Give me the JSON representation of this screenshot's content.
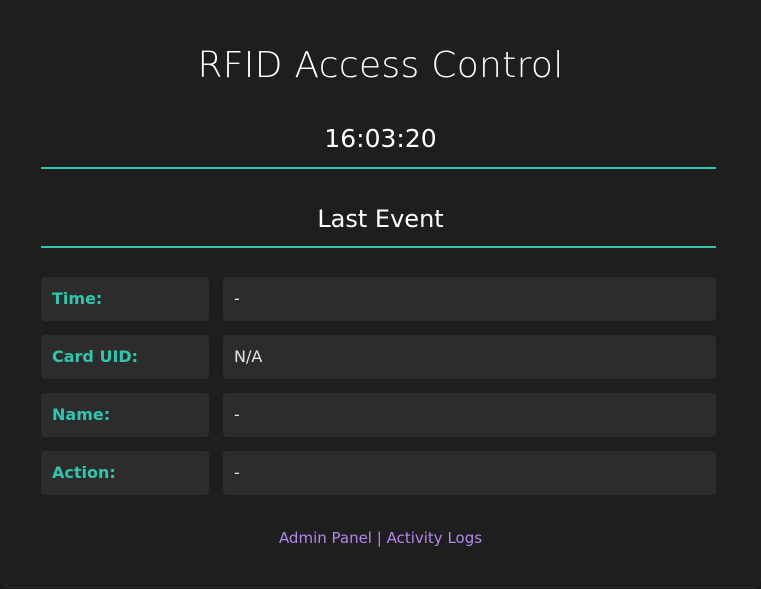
{
  "header": {
    "title": "RFID Access Control",
    "clock": "16:03:20"
  },
  "last_event": {
    "heading": "Last Event",
    "rows": [
      {
        "label": "Time:",
        "value": "-"
      },
      {
        "label": "Card UID:",
        "value": "N/A"
      },
      {
        "label": "Name:",
        "value": "-"
      },
      {
        "label": "Action:",
        "value": "-"
      }
    ]
  },
  "footer": {
    "admin_link": "Admin Panel",
    "separator": " | ",
    "logs_link": "Activity Logs"
  },
  "colors": {
    "accent": "#2fc6ad",
    "link": "#b388eb",
    "background": "#1e1e1e",
    "cell_background": "#2c2c2c"
  }
}
